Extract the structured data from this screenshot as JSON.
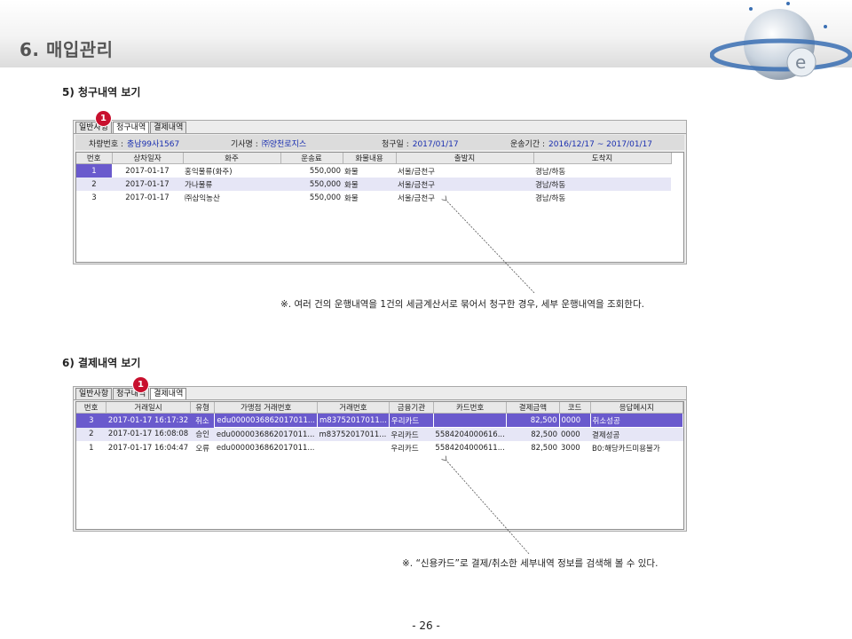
{
  "header": {
    "title": "6. 매입관리"
  },
  "section5": {
    "title": "5) 청구내역 보기",
    "tabs": [
      "일반사항",
      "청구내역",
      "결제내역"
    ],
    "badge": "1",
    "info": {
      "vehicle_label": "차량번호 :",
      "vehicle": "충남99사1567",
      "driver_label": "기사명 :",
      "driver": "㈜양천로지스",
      "bill_label": "청구일 :",
      "bill_date": "2017/01/17",
      "period_label": "운송기간 :",
      "period": "2016/12/17 ~ 2017/01/17"
    },
    "columns": [
      "번호",
      "상차일자",
      "화주",
      "운송료",
      "화물내용",
      "출발지",
      "도착지"
    ],
    "rows": [
      [
        "1",
        "2017-01-17",
        "홍익물류(화주)",
        "550,000",
        "화물",
        "서울/금천구",
        "경남/하동"
      ],
      [
        "2",
        "2017-01-17",
        "가나물류",
        "550,000",
        "화물",
        "서울/금천구",
        "경남/하동"
      ],
      [
        "3",
        "2017-01-17",
        "㈜삼익농산",
        "550,000",
        "화물",
        "서울/금천구",
        "경남/하동"
      ]
    ],
    "note": "※. 여러 건의 운행내역을 1건의 세금계산서로 묶어서 청구한 경우, 세부 운행내역을 조회한다."
  },
  "section6": {
    "title": "6) 결제내역 보기",
    "tabs": [
      "일반사항",
      "청구내역",
      "결제내역"
    ],
    "badge": "1",
    "columns": [
      "번호",
      "거래일시",
      "유형",
      "가맹점 거래번호",
      "거래번호",
      "금융기관",
      "카드번호",
      "결제금액",
      "코드",
      "응답메시지"
    ],
    "rows": [
      [
        "3",
        "2017-01-17 16:17:32",
        "취소",
        "edu0000036862017011...",
        "m83752017011...",
        "우리카드",
        "",
        "82,500",
        "0000",
        "취소성공"
      ],
      [
        "2",
        "2017-01-17 16:08:08",
        "승인",
        "edu0000036862017011...",
        "m83752017011...",
        "우리카드",
        "5584204000616...",
        "82,500",
        "0000",
        "결제성공"
      ],
      [
        "1",
        "2017-01-17 16:04:47",
        "오류",
        "edu0000036862017011...",
        "",
        "우리카드",
        "5584204000611...",
        "82,500",
        "3000",
        "B0:해당카드미용불가"
      ]
    ],
    "note": "※. “신용카드”로 결제/취소한 세부내역 정보를 검색해 볼 수 있다."
  },
  "footer": {
    "page": "- 26 -"
  }
}
